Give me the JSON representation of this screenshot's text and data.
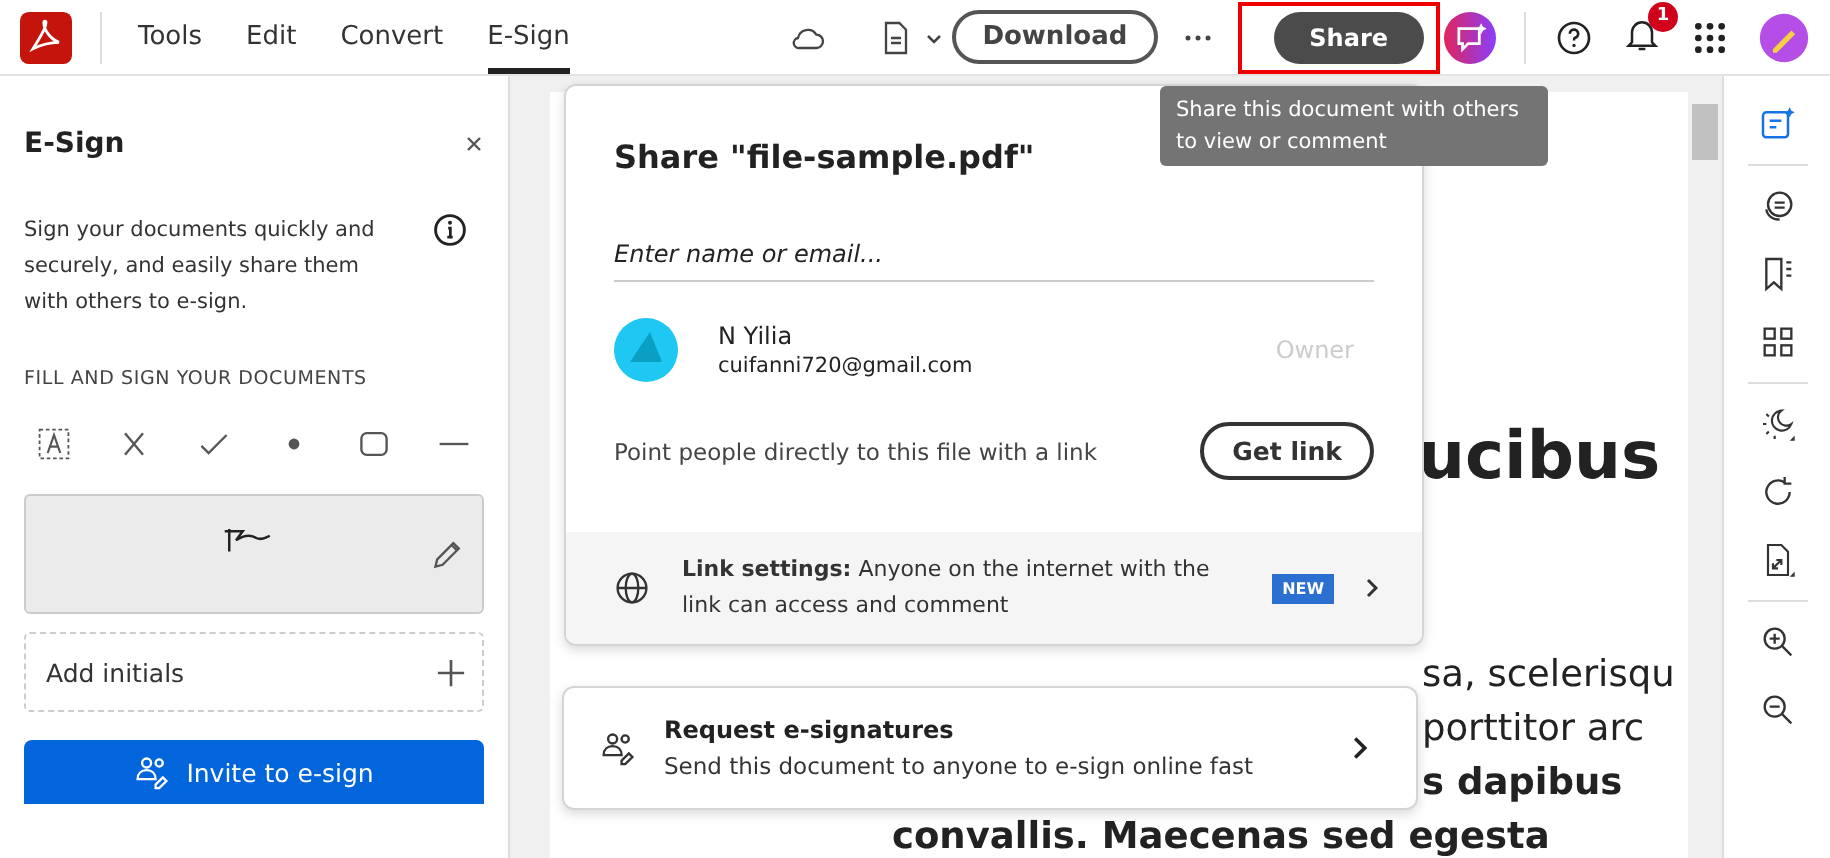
{
  "toolbar": {
    "menu": [
      {
        "label": "Tools",
        "selected": false
      },
      {
        "label": "Edit",
        "selected": false
      },
      {
        "label": "Convert",
        "selected": false
      },
      {
        "label": "E-Sign",
        "selected": true
      }
    ],
    "download": "Download",
    "share": "Share",
    "notifications": "1"
  },
  "tooltip": "Share this document with others to view or comment",
  "esign_panel": {
    "title": "E-Sign",
    "description": "Sign your documents quickly and securely, and easily share them with others to e-sign.",
    "section": "FILL AND SIGN YOUR DOCUMENTS",
    "add_initials": "Add initials",
    "invite": "Invite to e-sign"
  },
  "share_dialog": {
    "title": "Share \"file-sample.pdf\"",
    "placeholder": "Enter name or email...",
    "person": {
      "name": "N Yilia",
      "email": "cuifanni720@gmail.com",
      "role": "Owner"
    },
    "link_text": "Point people directly to this file with a link",
    "get_link": "Get link",
    "link_settings": "**Link settings:** Anyone on the internet with the link can access and comment",
    "badge": "NEW"
  },
  "request_card": {
    "title": "Request e-signatures",
    "subtitle": "Send this document to anyone to e-sign online fast"
  },
  "document": {
    "heading": "ucibus",
    "lines": [
      {
        "text": "sa, scelerisqu",
        "bold": false,
        "indent": true
      },
      {
        "text": "porttitor arc",
        "bold": false,
        "indent": true
      },
      {
        "text": "s dapibus",
        "bold": true,
        "indent": true
      },
      {
        "text": "convallis. Maecenas sed egesta",
        "bold": true,
        "indent": false
      }
    ]
  }
}
